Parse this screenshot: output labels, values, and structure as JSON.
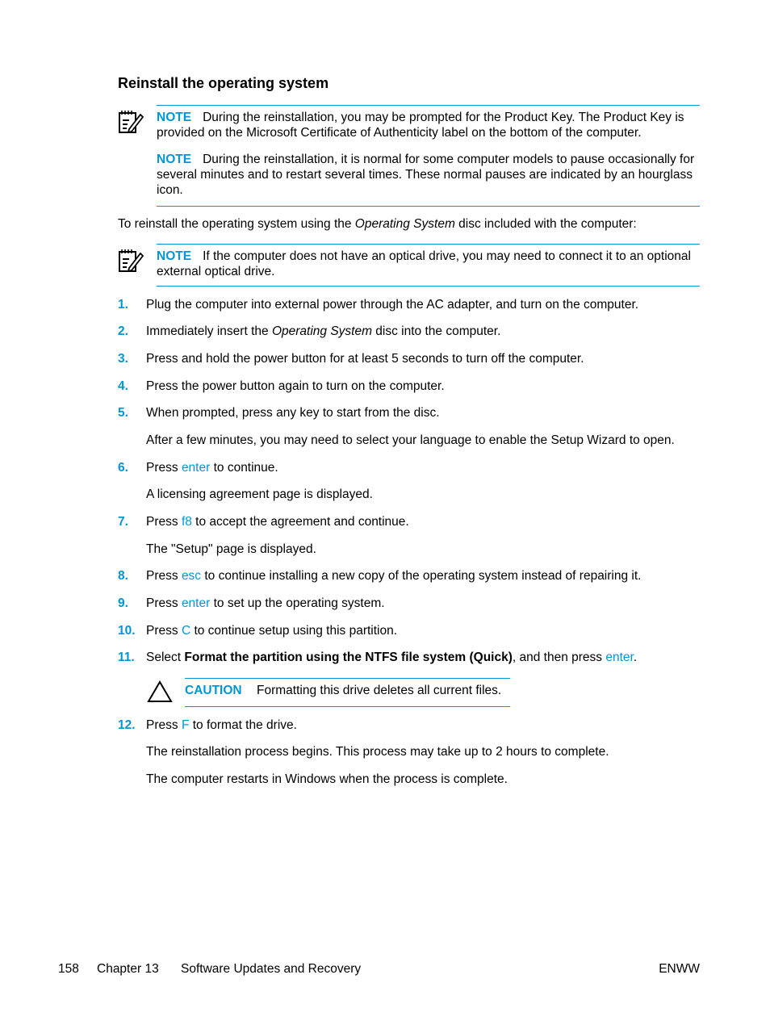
{
  "heading": "Reinstall the operating system",
  "accent_color": "#0096d6",
  "note_block_1": {
    "icon": "note-pencil-icon",
    "notes": [
      {
        "label": "NOTE",
        "text": "During the reinstallation, you may be prompted for the Product Key. The Product Key is provided on the Microsoft Certificate of Authenticity label on the bottom of the computer."
      },
      {
        "label": "NOTE",
        "text": "During the reinstallation, it is normal for some computer models to pause occasionally for several minutes and to restart several times. These normal pauses are indicated by an hourglass icon."
      }
    ]
  },
  "intro": {
    "before": "To reinstall the operating system using the ",
    "italic": "Operating System",
    "after": " disc included with the computer:"
  },
  "note_block_2": {
    "icon": "note-pencil-icon",
    "label": "NOTE",
    "text": "If the computer does not have an optical drive, you may need to connect it to an optional external optical drive."
  },
  "steps": [
    {
      "num": "1.",
      "text": "Plug the computer into external power through the AC adapter, and turn on the computer."
    },
    {
      "num": "2.",
      "before": "Immediately insert the ",
      "italic": "Operating System",
      "after": " disc into the computer."
    },
    {
      "num": "3.",
      "text": "Press and hold the power button for at least 5 seconds to turn off the computer."
    },
    {
      "num": "4.",
      "text": "Press the power button again to turn on the computer."
    },
    {
      "num": "5.",
      "text": "When prompted, press any key to start from the disc.",
      "sub": [
        "After a few minutes, you may need to select your language to enable the Setup Wizard to open."
      ]
    },
    {
      "num": "6.",
      "before": "Press ",
      "key": "enter",
      "after": " to continue.",
      "sub": [
        "A licensing agreement page is displayed."
      ]
    },
    {
      "num": "7.",
      "before": "Press ",
      "key": "f8",
      "after": " to accept the agreement and continue.",
      "sub": [
        "The \"Setup\" page is displayed."
      ]
    },
    {
      "num": "8.",
      "before": "Press ",
      "key": "esc",
      "after": " to continue installing a new copy of the operating system instead of repairing it."
    },
    {
      "num": "9.",
      "before": "Press ",
      "key": "enter",
      "after": " to set up the operating system."
    },
    {
      "num": "10.",
      "before": "Press ",
      "key": "C",
      "after": " to continue setup using this partition."
    },
    {
      "num": "11.",
      "before": "Select ",
      "bold": "Format the partition using the NTFS file system (Quick)",
      "middle": ", and then press ",
      "key": "enter",
      "after": "."
    },
    {
      "num": "12.",
      "before": "Press ",
      "key": "F",
      "after": " to format the drive.",
      "sub": [
        "The reinstallation process begins. This process may take up to 2 hours to complete.",
        "The computer restarts in Windows when the process is complete."
      ]
    }
  ],
  "caution": {
    "icon": "warning-triangle-icon",
    "label": "CAUTION",
    "text": "Formatting this drive deletes all current files."
  },
  "footer": {
    "page_number": "158",
    "chapter": "Chapter 13",
    "chapter_title": "Software Updates and Recovery",
    "right": "ENWW"
  }
}
